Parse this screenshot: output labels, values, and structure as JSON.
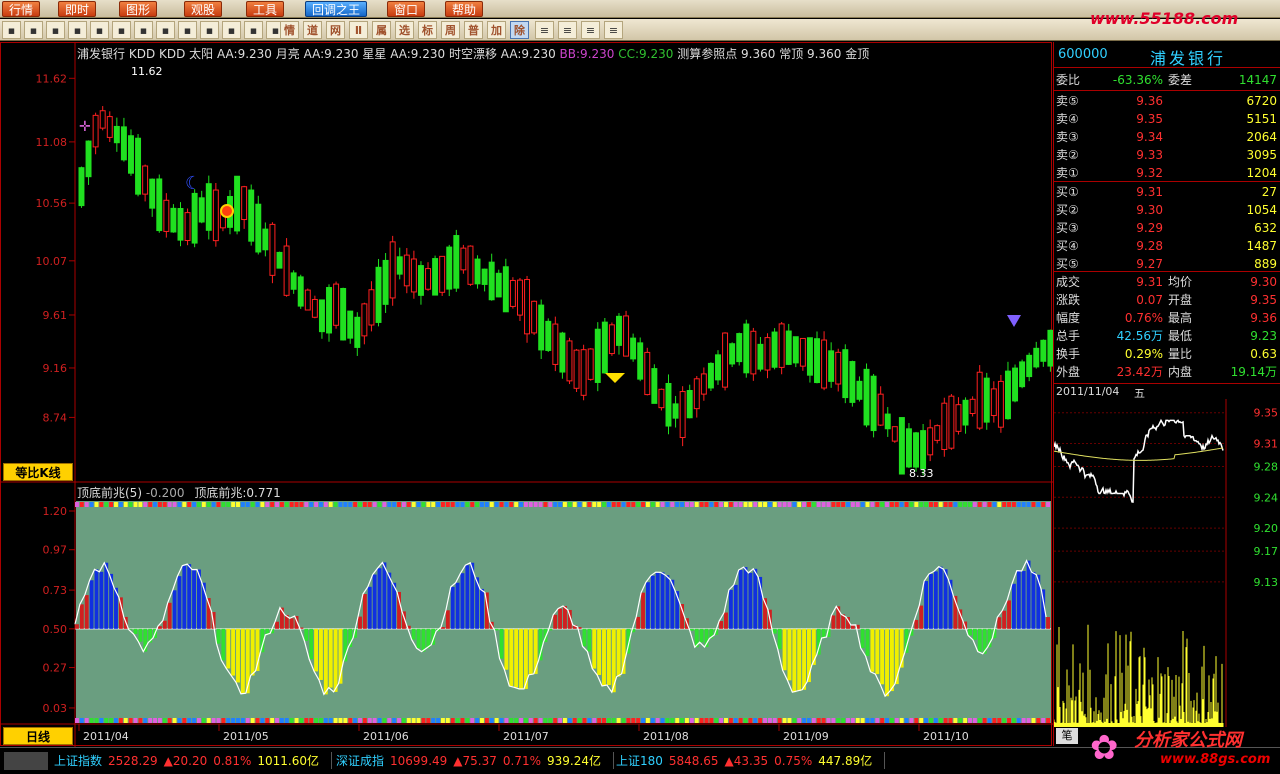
{
  "menu": [
    "行情",
    "即时",
    "图形",
    "观股",
    "工具",
    "回调之王",
    "窗口",
    "帮助"
  ],
  "toolbar": {
    "text_buttons": [
      "情",
      "道",
      "网",
      "Ⅱ",
      "属",
      "选",
      "标",
      "周",
      "普",
      "加",
      "除"
    ]
  },
  "logo": "www.55188.com",
  "stock": {
    "name": "浦发银行",
    "code": "600000"
  },
  "legend_top": [
    {
      "text": "浦发银行",
      "color": "#dddddd"
    },
    {
      "text": "KDD",
      "color": "#dddddd"
    },
    {
      "text": "KDD",
      "color": "#dddddd"
    },
    {
      "text": "太阳",
      "color": "#dddddd"
    },
    {
      "text": "AA:9.230",
      "color": "#dddddd"
    },
    {
      "text": "月亮",
      "color": "#dddddd"
    },
    {
      "text": "AA:9.230",
      "color": "#dddddd"
    },
    {
      "text": "星星",
      "color": "#dddddd"
    },
    {
      "text": "AA:9.230",
      "color": "#dddddd"
    },
    {
      "text": "时空漂移",
      "color": "#dddddd"
    },
    {
      "text": "AA:9.230",
      "color": "#dddddd"
    },
    {
      "text": "BB:9.230",
      "color": "#cc44cc"
    },
    {
      "text": "CC:9.230",
      "color": "#30c030"
    },
    {
      "text": "测算参照点",
      "color": "#dddddd"
    },
    {
      "text": "9.360",
      "color": "#dddddd"
    },
    {
      "text": "常顶",
      "color": "#dddddd"
    },
    {
      "text": "9.360",
      "color": "#dddddd"
    },
    {
      "text": "金顶",
      "color": "#dddddd"
    }
  ],
  "price_axis": [
    "11.62",
    "11.08",
    "10.56",
    "10.07",
    "9.61",
    "9.16",
    "8.74"
  ],
  "price_marks": {
    "high": "11.62",
    "low": "8.33"
  },
  "indicator_legend": {
    "name": "顶底前兆(5)",
    "v1": "-0.200",
    "name2": "顶底前兆",
    "v2": "0.771"
  },
  "indicator_axis": [
    "1.20",
    "0.97",
    "0.73",
    "0.50",
    "0.27",
    "0.03"
  ],
  "date_axis": [
    "2011/04",
    "2011/05",
    "2011/06",
    "2011/07",
    "2011/08",
    "2011/09",
    "2011/10"
  ],
  "badges": {
    "scale": "等比K线",
    "period": "日线"
  },
  "quote": {
    "weibi_label": "委比",
    "weibi": "-63.36%",
    "weicha_label": "委差",
    "weicha": "14147",
    "asks": [
      {
        "l": "卖⑤",
        "p": "9.36",
        "v": "6720"
      },
      {
        "l": "卖④",
        "p": "9.35",
        "v": "5151"
      },
      {
        "l": "卖③",
        "p": "9.34",
        "v": "2064"
      },
      {
        "l": "卖②",
        "p": "9.33",
        "v": "3095"
      },
      {
        "l": "卖①",
        "p": "9.32",
        "v": "1204"
      }
    ],
    "bids": [
      {
        "l": "买①",
        "p": "9.31",
        "v": "27"
      },
      {
        "l": "买②",
        "p": "9.30",
        "v": "1054"
      },
      {
        "l": "买③",
        "p": "9.29",
        "v": "632"
      },
      {
        "l": "买④",
        "p": "9.28",
        "v": "1487"
      },
      {
        "l": "买⑤",
        "p": "9.27",
        "v": "889"
      }
    ],
    "stats": [
      {
        "l1": "成交",
        "v1": "9.31",
        "c1": "#ff3030",
        "l2": "均价",
        "v2": "9.30",
        "c2": "#ff3030"
      },
      {
        "l1": "涨跌",
        "v1": "0.07",
        "c1": "#ff3030",
        "l2": "开盘",
        "v2": "9.35",
        "c2": "#ff3030"
      },
      {
        "l1": "幅度",
        "v1": "0.76%",
        "c1": "#ff3030",
        "l2": "最高",
        "v2": "9.36",
        "c2": "#ff3030"
      },
      {
        "l1": "总手",
        "v1": "42.56万",
        "c1": "#30d0ff",
        "l2": "最低",
        "v2": "9.23",
        "c2": "#30e030"
      },
      {
        "l1": "换手",
        "v1": "0.29%",
        "c1": "#ffff30",
        "l2": "量比",
        "v2": "0.63",
        "c2": "#ffff30"
      },
      {
        "l1": "外盘",
        "v1": "23.42万",
        "c1": "#ff3030",
        "l2": "内盘",
        "v2": "19.14万",
        "c2": "#30e030"
      }
    ],
    "intraday_date": "2011/11/04",
    "intraday_weekday": "五",
    "intraday_axis": [
      "9.35",
      "9.31",
      "9.28",
      "9.24",
      "9.20",
      "9.17",
      "9.13"
    ],
    "bottom_tab": "笔"
  },
  "status": [
    {
      "name": "上证指数",
      "v1": "2528.29",
      "v2": "▲20.20",
      "v3": "0.81%",
      "v4": "1011.60亿"
    },
    {
      "name": "深证成指",
      "v1": "10699.49",
      "v2": "▲75.37",
      "v3": "0.71%",
      "v4": "939.24亿"
    },
    {
      "name": "上证180",
      "v1": "5848.65",
      "v2": "▲43.35",
      "v3": "0.75%",
      "v4": "447.89亿"
    }
  ],
  "watermark": "分析家公式网",
  "watermark_url": "www.88gs.com",
  "colors": {
    "up": "#ff2020",
    "down": "#20e020",
    "panel_bg": "#6a9e80",
    "grid": "#a00000"
  }
}
